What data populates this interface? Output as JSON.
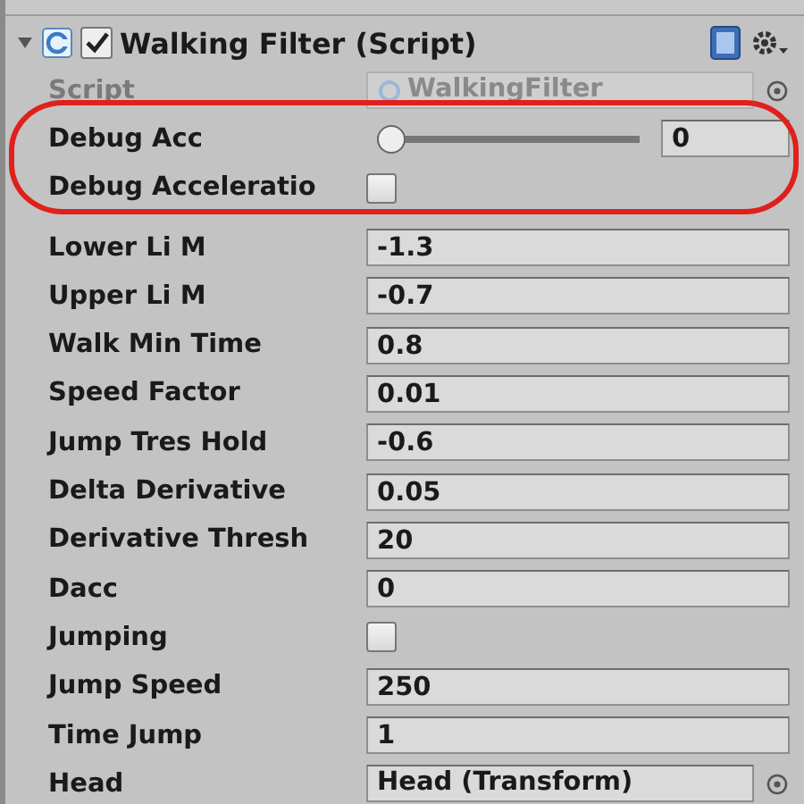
{
  "component": {
    "title": "Walking Filter (Script)",
    "enabled": true,
    "expanded": true
  },
  "annotation": {
    "kind": "ellipse",
    "color": "#e0201c"
  },
  "fields": [
    {
      "kind": "script",
      "label": "Script",
      "value": "WalkingFilter",
      "disabled": true
    },
    {
      "kind": "slider",
      "label": "Debug Acc",
      "level": 0.0,
      "value": "0"
    },
    {
      "kind": "checkbox",
      "label": "Debug Acceleratio",
      "checked": false
    },
    {
      "kind": "number",
      "label": "Lower Li M",
      "value": "-1.3"
    },
    {
      "kind": "number",
      "label": "Upper Li M",
      "value": "-0.7"
    },
    {
      "kind": "number",
      "label": "Walk Min Time",
      "value": "0.8"
    },
    {
      "kind": "number",
      "label": "Speed Factor",
      "value": "0.01"
    },
    {
      "kind": "number",
      "label": "Jump Tres Hold",
      "value": "-0.6"
    },
    {
      "kind": "number",
      "label": "Delta Derivative",
      "value": "0.05"
    },
    {
      "kind": "number",
      "label": "Derivative Thresh",
      "value": "20"
    },
    {
      "kind": "number",
      "label": "Dacc",
      "value": "0"
    },
    {
      "kind": "checkbox",
      "label": "Jumping",
      "checked": false
    },
    {
      "kind": "number",
      "label": "Jump Speed",
      "value": "250"
    },
    {
      "kind": "number",
      "label": "Time Jump",
      "value": "1"
    },
    {
      "kind": "object",
      "label": "Head",
      "value": "Head (Transform)"
    }
  ]
}
